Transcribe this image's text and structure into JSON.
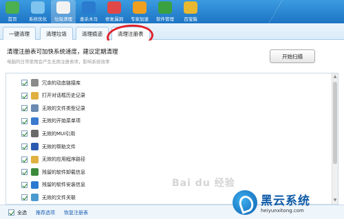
{
  "nav": {
    "items": [
      {
        "label": "首页",
        "icon": "house-icon",
        "color": "#4caf50"
      },
      {
        "label": "系统优化",
        "icon": "gauge-icon",
        "color": "#7ec4ee"
      },
      {
        "label": "垃圾清理",
        "icon": "broom-icon",
        "color": "#f2f2f2",
        "active": true
      },
      {
        "label": "查杀木马",
        "icon": "horse-icon",
        "color": "#2a7ad0"
      },
      {
        "label": "修复漏洞",
        "icon": "patch-icon",
        "color": "#e04848"
      },
      {
        "label": "专家加速",
        "icon": "speed-icon",
        "color": "#f0a020"
      },
      {
        "label": "软件管理",
        "icon": "window-icon",
        "color": "#3aa040"
      },
      {
        "label": "百宝箱",
        "icon": "toolbox-icon",
        "color": "#e8b830"
      }
    ]
  },
  "tabs": [
    {
      "label": "一键清理"
    },
    {
      "label": "清理垃圾"
    },
    {
      "label": "清理痕迹"
    },
    {
      "label": "清理注册表",
      "active": true
    }
  ],
  "info": {
    "title": "清理注册表可加快系统速度，建议定期清理",
    "subtitle": "电脑的日常使用会产生无用注册表项，影响系统效率",
    "scan_button": "开始扫描"
  },
  "list": [
    {
      "label": "冗余的动态链接库",
      "icon": "gear-icon",
      "color": "#8a8a8a"
    },
    {
      "label": "打开对话框历史记录",
      "icon": "folder-icon",
      "color": "#e0b040"
    },
    {
      "label": "无效的文件类型记录",
      "icon": "file-icon",
      "color": "#6a8ab0"
    },
    {
      "label": "无效的开始菜单项",
      "icon": "start-menu-icon",
      "color": "#3a7ad0"
    },
    {
      "label": "无效的MUI引用",
      "icon": "mui-icon",
      "color": "#6a6a6a"
    },
    {
      "label": "无效的帮助文件",
      "icon": "help-icon",
      "color": "#2a5ab0"
    },
    {
      "label": "无效的应用程序路径",
      "icon": "folder-icon",
      "color": "#e0b040"
    },
    {
      "label": "残留的软件卸载信息",
      "icon": "uninstall-icon",
      "color": "#3a8a3a"
    },
    {
      "label": "残留的软件安装信息",
      "icon": "install-icon",
      "color": "#2a7ad0"
    },
    {
      "label": "无效的文件关联",
      "icon": "link-icon",
      "color": "#4a9ad0"
    }
  ],
  "bottom": {
    "select_all": "全选",
    "recommend": "推荐选项",
    "restore": "恢复注册表"
  },
  "watermark": {
    "baidu": "Bai du 经验",
    "brand_name": "黑云系统",
    "brand_url": "heiyunxitong.com"
  }
}
